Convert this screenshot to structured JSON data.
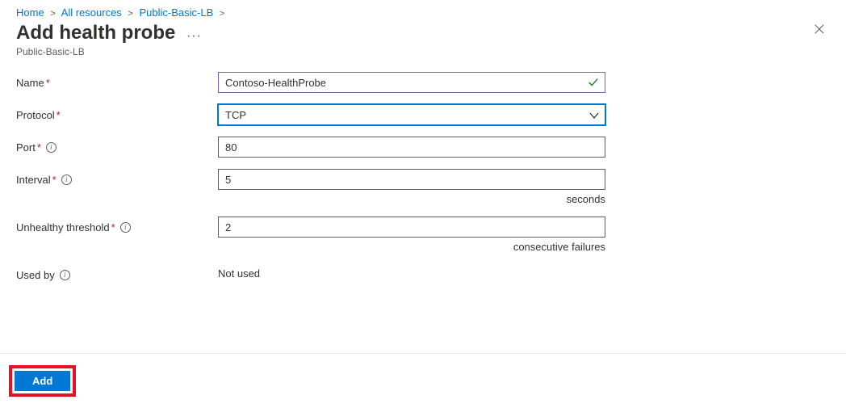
{
  "breadcrumb": {
    "items": [
      "Home",
      "All resources",
      "Public-Basic-LB"
    ],
    "trailing": true
  },
  "header": {
    "title": "Add health probe",
    "subtitle": "Public-Basic-LB"
  },
  "form": {
    "name": {
      "label": "Name",
      "value": "Contoso-HealthProbe",
      "required": true
    },
    "protocol": {
      "label": "Protocol",
      "value": "TCP",
      "required": true
    },
    "port": {
      "label": "Port",
      "value": "80",
      "required": true
    },
    "interval": {
      "label": "Interval",
      "value": "5",
      "required": true,
      "hint": "seconds"
    },
    "threshold": {
      "label": "Unhealthy threshold",
      "value": "2",
      "required": true,
      "hint": "consecutive failures"
    },
    "usedby": {
      "label": "Used by",
      "value": "Not used"
    }
  },
  "footer": {
    "add_label": "Add"
  }
}
